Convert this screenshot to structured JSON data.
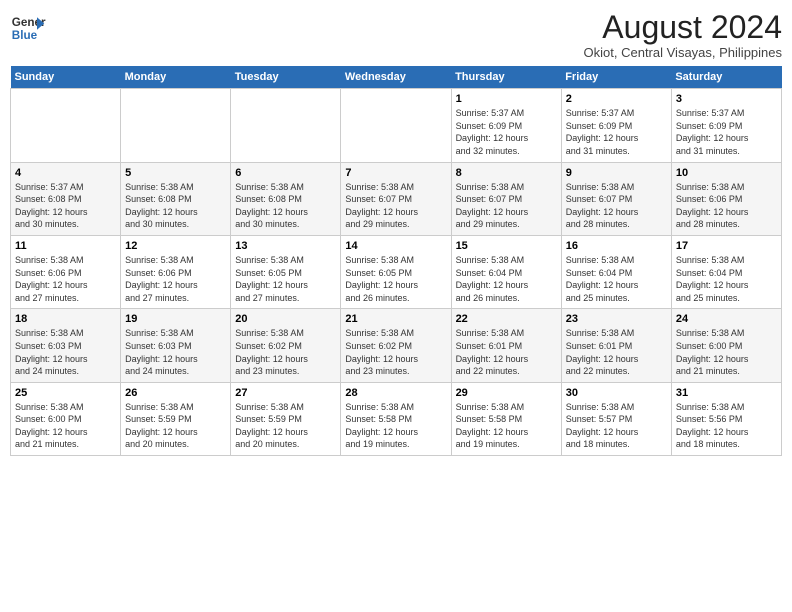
{
  "header": {
    "logo_line1": "General",
    "logo_line2": "Blue",
    "title": "August 2024",
    "subtitle": "Okiot, Central Visayas, Philippines"
  },
  "days_of_week": [
    "Sunday",
    "Monday",
    "Tuesday",
    "Wednesday",
    "Thursday",
    "Friday",
    "Saturday"
  ],
  "weeks": [
    [
      {
        "day": "",
        "info": ""
      },
      {
        "day": "",
        "info": ""
      },
      {
        "day": "",
        "info": ""
      },
      {
        "day": "",
        "info": ""
      },
      {
        "day": "1",
        "info": "Sunrise: 5:37 AM\nSunset: 6:09 PM\nDaylight: 12 hours\nand 32 minutes."
      },
      {
        "day": "2",
        "info": "Sunrise: 5:37 AM\nSunset: 6:09 PM\nDaylight: 12 hours\nand 31 minutes."
      },
      {
        "day": "3",
        "info": "Sunrise: 5:37 AM\nSunset: 6:09 PM\nDaylight: 12 hours\nand 31 minutes."
      }
    ],
    [
      {
        "day": "4",
        "info": "Sunrise: 5:37 AM\nSunset: 6:08 PM\nDaylight: 12 hours\nand 30 minutes."
      },
      {
        "day": "5",
        "info": "Sunrise: 5:38 AM\nSunset: 6:08 PM\nDaylight: 12 hours\nand 30 minutes."
      },
      {
        "day": "6",
        "info": "Sunrise: 5:38 AM\nSunset: 6:08 PM\nDaylight: 12 hours\nand 30 minutes."
      },
      {
        "day": "7",
        "info": "Sunrise: 5:38 AM\nSunset: 6:07 PM\nDaylight: 12 hours\nand 29 minutes."
      },
      {
        "day": "8",
        "info": "Sunrise: 5:38 AM\nSunset: 6:07 PM\nDaylight: 12 hours\nand 29 minutes."
      },
      {
        "day": "9",
        "info": "Sunrise: 5:38 AM\nSunset: 6:07 PM\nDaylight: 12 hours\nand 28 minutes."
      },
      {
        "day": "10",
        "info": "Sunrise: 5:38 AM\nSunset: 6:06 PM\nDaylight: 12 hours\nand 28 minutes."
      }
    ],
    [
      {
        "day": "11",
        "info": "Sunrise: 5:38 AM\nSunset: 6:06 PM\nDaylight: 12 hours\nand 27 minutes."
      },
      {
        "day": "12",
        "info": "Sunrise: 5:38 AM\nSunset: 6:06 PM\nDaylight: 12 hours\nand 27 minutes."
      },
      {
        "day": "13",
        "info": "Sunrise: 5:38 AM\nSunset: 6:05 PM\nDaylight: 12 hours\nand 27 minutes."
      },
      {
        "day": "14",
        "info": "Sunrise: 5:38 AM\nSunset: 6:05 PM\nDaylight: 12 hours\nand 26 minutes."
      },
      {
        "day": "15",
        "info": "Sunrise: 5:38 AM\nSunset: 6:04 PM\nDaylight: 12 hours\nand 26 minutes."
      },
      {
        "day": "16",
        "info": "Sunrise: 5:38 AM\nSunset: 6:04 PM\nDaylight: 12 hours\nand 25 minutes."
      },
      {
        "day": "17",
        "info": "Sunrise: 5:38 AM\nSunset: 6:04 PM\nDaylight: 12 hours\nand 25 minutes."
      }
    ],
    [
      {
        "day": "18",
        "info": "Sunrise: 5:38 AM\nSunset: 6:03 PM\nDaylight: 12 hours\nand 24 minutes."
      },
      {
        "day": "19",
        "info": "Sunrise: 5:38 AM\nSunset: 6:03 PM\nDaylight: 12 hours\nand 24 minutes."
      },
      {
        "day": "20",
        "info": "Sunrise: 5:38 AM\nSunset: 6:02 PM\nDaylight: 12 hours\nand 23 minutes."
      },
      {
        "day": "21",
        "info": "Sunrise: 5:38 AM\nSunset: 6:02 PM\nDaylight: 12 hours\nand 23 minutes."
      },
      {
        "day": "22",
        "info": "Sunrise: 5:38 AM\nSunset: 6:01 PM\nDaylight: 12 hours\nand 22 minutes."
      },
      {
        "day": "23",
        "info": "Sunrise: 5:38 AM\nSunset: 6:01 PM\nDaylight: 12 hours\nand 22 minutes."
      },
      {
        "day": "24",
        "info": "Sunrise: 5:38 AM\nSunset: 6:00 PM\nDaylight: 12 hours\nand 21 minutes."
      }
    ],
    [
      {
        "day": "25",
        "info": "Sunrise: 5:38 AM\nSunset: 6:00 PM\nDaylight: 12 hours\nand 21 minutes."
      },
      {
        "day": "26",
        "info": "Sunrise: 5:38 AM\nSunset: 5:59 PM\nDaylight: 12 hours\nand 20 minutes."
      },
      {
        "day": "27",
        "info": "Sunrise: 5:38 AM\nSunset: 5:59 PM\nDaylight: 12 hours\nand 20 minutes."
      },
      {
        "day": "28",
        "info": "Sunrise: 5:38 AM\nSunset: 5:58 PM\nDaylight: 12 hours\nand 19 minutes."
      },
      {
        "day": "29",
        "info": "Sunrise: 5:38 AM\nSunset: 5:58 PM\nDaylight: 12 hours\nand 19 minutes."
      },
      {
        "day": "30",
        "info": "Sunrise: 5:38 AM\nSunset: 5:57 PM\nDaylight: 12 hours\nand 18 minutes."
      },
      {
        "day": "31",
        "info": "Sunrise: 5:38 AM\nSunset: 5:56 PM\nDaylight: 12 hours\nand 18 minutes."
      }
    ]
  ]
}
